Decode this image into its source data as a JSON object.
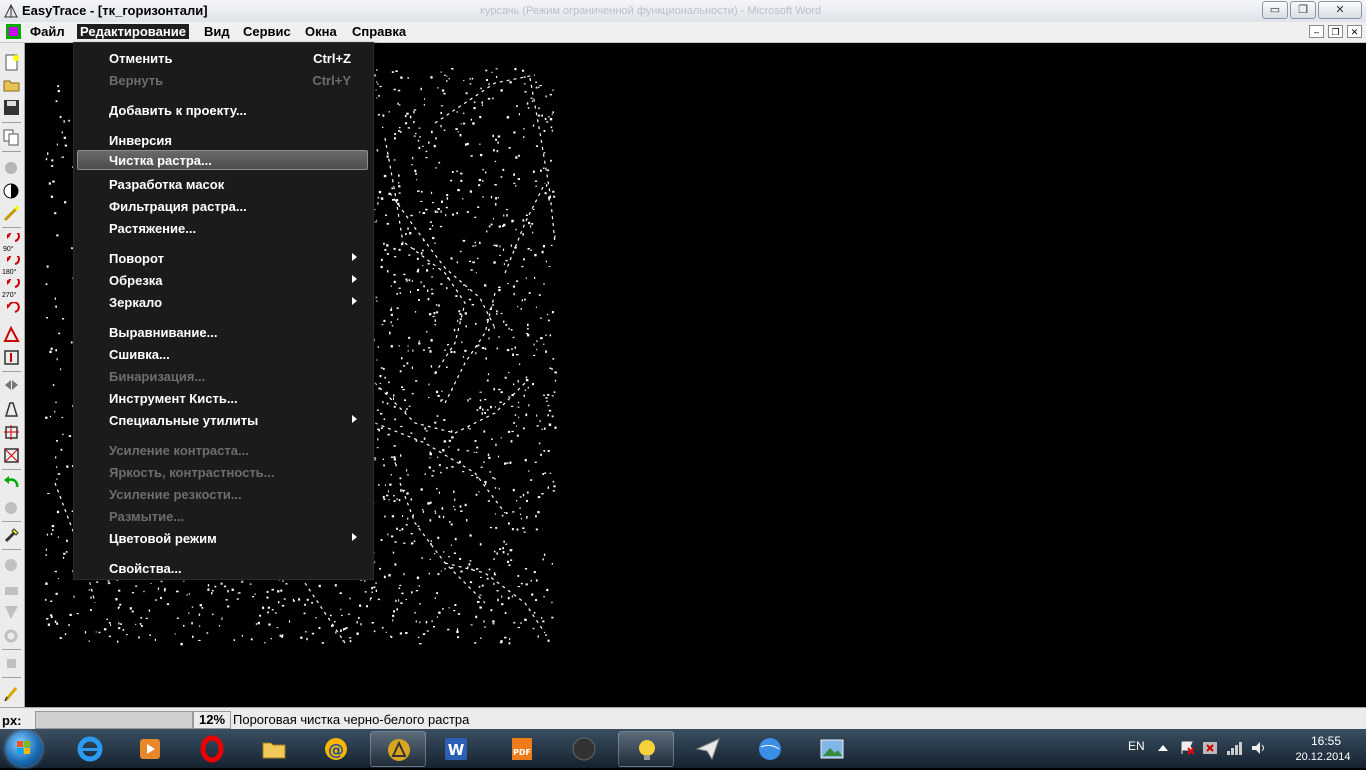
{
  "window": {
    "title": "EasyTrace - [тк_горизонтали]",
    "background_title": "курсачь (Режим ограниченной функциональности) - Microsoft Word",
    "minimize": "▭",
    "maximize": "❐",
    "close": "✕"
  },
  "menubar": {
    "items": [
      "Файл",
      "Редактирование",
      "Вид",
      "Сервис",
      "Окна",
      "Справка"
    ],
    "active_index": 1,
    "mdi_min": "–",
    "mdi_restore": "❐",
    "mdi_close": "✕"
  },
  "edit_menu": {
    "items": [
      {
        "label": "Отменить",
        "shortcut": "Ctrl+Z",
        "enabled": true
      },
      {
        "label": "Вернуть",
        "shortcut": "Ctrl+Y",
        "enabled": false
      },
      {
        "label": "Добавить к проекту...",
        "enabled": true
      },
      {
        "label": "Инверсия",
        "enabled": true
      },
      {
        "label": "Чистка растра...",
        "enabled": true,
        "highlighted": true
      },
      {
        "label": "Разработка масок",
        "enabled": true
      },
      {
        "label": "Фильтрация растра...",
        "enabled": true
      },
      {
        "label": "Растяжение...",
        "enabled": true
      },
      {
        "label": "Поворот",
        "enabled": true,
        "submenu": true
      },
      {
        "label": "Обрезка",
        "enabled": true,
        "submenu": true
      },
      {
        "label": "Зеркало",
        "enabled": true,
        "submenu": true
      },
      {
        "label": "Выравнивание...",
        "enabled": true
      },
      {
        "label": "Сшивка...",
        "enabled": true
      },
      {
        "label": "Бинаризация...",
        "enabled": false
      },
      {
        "label": "Инструмент Кисть...",
        "enabled": true
      },
      {
        "label": "Специальные утилиты",
        "enabled": true,
        "submenu": true
      },
      {
        "label": "Усиление контраста...",
        "enabled": false
      },
      {
        "label": "Яркость, контрастность...",
        "enabled": false
      },
      {
        "label": "Усиление резкости...",
        "enabled": false
      },
      {
        "label": "Размытие...",
        "enabled": false
      },
      {
        "label": "Цветовой режим",
        "enabled": true,
        "submenu": true
      },
      {
        "label": "Свойства...",
        "enabled": true
      }
    ]
  },
  "toolbar": {
    "rotate_90": "90°",
    "rotate_180": "180°",
    "rotate_270": "270°"
  },
  "statusbar": {
    "units": "px:",
    "zoom": "12%",
    "message": "Пороговая чистка черно-белого растра"
  },
  "taskbar": {
    "apps": [
      "internet-explorer",
      "media-player",
      "opera",
      "file-explorer",
      "mail-agent",
      "easytrace",
      "word",
      "pdf-reader",
      "app-dark",
      "lightbulb-app",
      "paper-plane-app",
      "browser-globe",
      "image-viewer"
    ],
    "active_app": "easytrace",
    "language": "EN",
    "time": "16:55",
    "date": "20.12.2014"
  },
  "colors": {
    "menu_bg": "#1b1b1b",
    "highlight": "#5c5c5c",
    "canvas": "#000000"
  }
}
